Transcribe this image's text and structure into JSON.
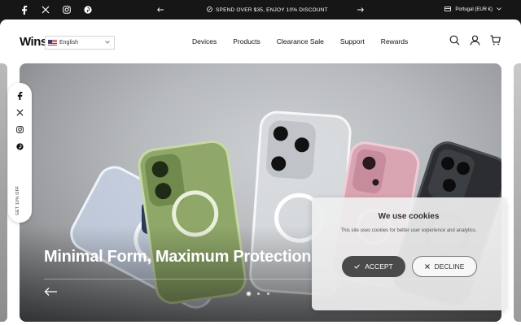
{
  "announcement": {
    "social_icons": [
      "facebook-icon",
      "x-icon",
      "instagram-icon",
      "pinterest-icon"
    ],
    "promo_text": "SPEND OVER $35, ENJOY 10% DISCOUNT",
    "locale": "Portugal (EUR €)"
  },
  "header": {
    "logo": "Wins",
    "language": "English",
    "nav": [
      "Devices",
      "Products",
      "Clearance Sale",
      "Support",
      "Rewards"
    ],
    "icons": [
      "search-icon",
      "account-icon",
      "cart-icon"
    ]
  },
  "hero": {
    "title": "Minimal Form, Maximum Protection",
    "slide_count": 3,
    "active_slide": 1
  },
  "float_social": {
    "icons": [
      "facebook-icon",
      "x-icon",
      "instagram-icon",
      "pinterest-icon"
    ],
    "promo": "GET 10% OFF"
  },
  "cookie": {
    "title": "We use cookies",
    "description": "This site uses cookies for better user experience and analytics.",
    "accept_label": "ACCEPT",
    "decline_label": "DECLINE"
  },
  "colors": {
    "topbar": "#161616",
    "accept_button": "#4a4a4a",
    "text_dark": "#111111"
  }
}
